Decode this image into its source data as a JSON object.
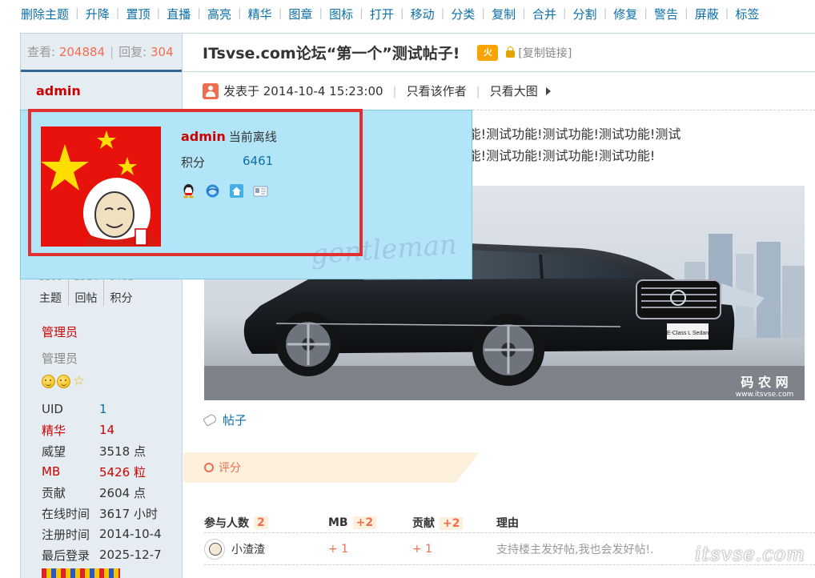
{
  "toolbar": {
    "items": [
      "删除主题",
      "升降",
      "置顶",
      "直播",
      "高亮",
      "精华",
      "图章",
      "图标",
      "打开",
      "移动",
      "分类",
      "复制",
      "合并",
      "分割",
      "修复",
      "警告",
      "屏蔽",
      "标签"
    ]
  },
  "sidebar": {
    "views_label": "查看:",
    "views": "204884",
    "replies_label": "回复:",
    "replies": "304",
    "author": "admin",
    "counts": [
      {
        "value": "1100",
        "label": "主题"
      },
      {
        "value": "1314",
        "label": "回帖"
      },
      {
        "value": "6461",
        "label": "积分"
      }
    ],
    "group_title": "管理员",
    "group_subtitle": "管理员",
    "profile": [
      {
        "key": "UID",
        "value": "1"
      },
      {
        "key": "精华",
        "value": "14"
      },
      {
        "key": "威望",
        "value": "3518 点"
      },
      {
        "key": "MB",
        "value": "5426 粒"
      },
      {
        "key": "贡献",
        "value": "2604 点"
      },
      {
        "key": "在线时间",
        "value": "3617 小时"
      },
      {
        "key": "注册时间",
        "value": "2014-10-4"
      },
      {
        "key": "最后登录",
        "value": "2025-12-7"
      }
    ]
  },
  "post": {
    "title": "ITsvse.com论坛“第一个”测试帖子!",
    "hot_badge": "火",
    "copy_link": "[复制链接]",
    "posted_at": "发表于 2014-10-4 15:23:00",
    "only_author": "只看该作者",
    "only_big_image": "只看大图",
    "text_line1": "测试功能!测试功能!测试功能!测试功能!测试功能!测试功能!测试功能!测试功能!测试",
    "text_line2": "测试功能!测试功能!测试功能!测试功能!测试功能!测试功能!测试功能!测试功能!",
    "image_brand": "码 农 网",
    "image_url_text": "www.itsvse.com",
    "plate_text": "E-Class L Sedan",
    "tag": "帖子"
  },
  "rating": {
    "label": "评分",
    "headers": {
      "participants": "参与人数",
      "participants_count": "2",
      "mb": "MB",
      "mb_total": "+2",
      "contrib": "贡献",
      "contrib_total": "+2",
      "reason": "理由"
    },
    "rows": [
      {
        "user": "小渣渣",
        "mb": "+ 1",
        "contrib": "+ 1",
        "reason": "支持楼主发好帖,我也会发好帖!."
      }
    ]
  },
  "watermark": "itsvse.com",
  "popup": {
    "name": "admin",
    "status": "当前离线",
    "points_label": "积分",
    "points": "6461",
    "watermark": "gentleman",
    "icons": [
      "qq-icon",
      "globe-icon",
      "home-icon",
      "profile-card-icon"
    ]
  },
  "colors": {
    "link_blue": "#0b6fa8",
    "accent_red": "#c00",
    "popup_bg": "#b3e5f8",
    "highlight_border": "#e22f2f",
    "sidebar_bg": "#e5edf2"
  }
}
